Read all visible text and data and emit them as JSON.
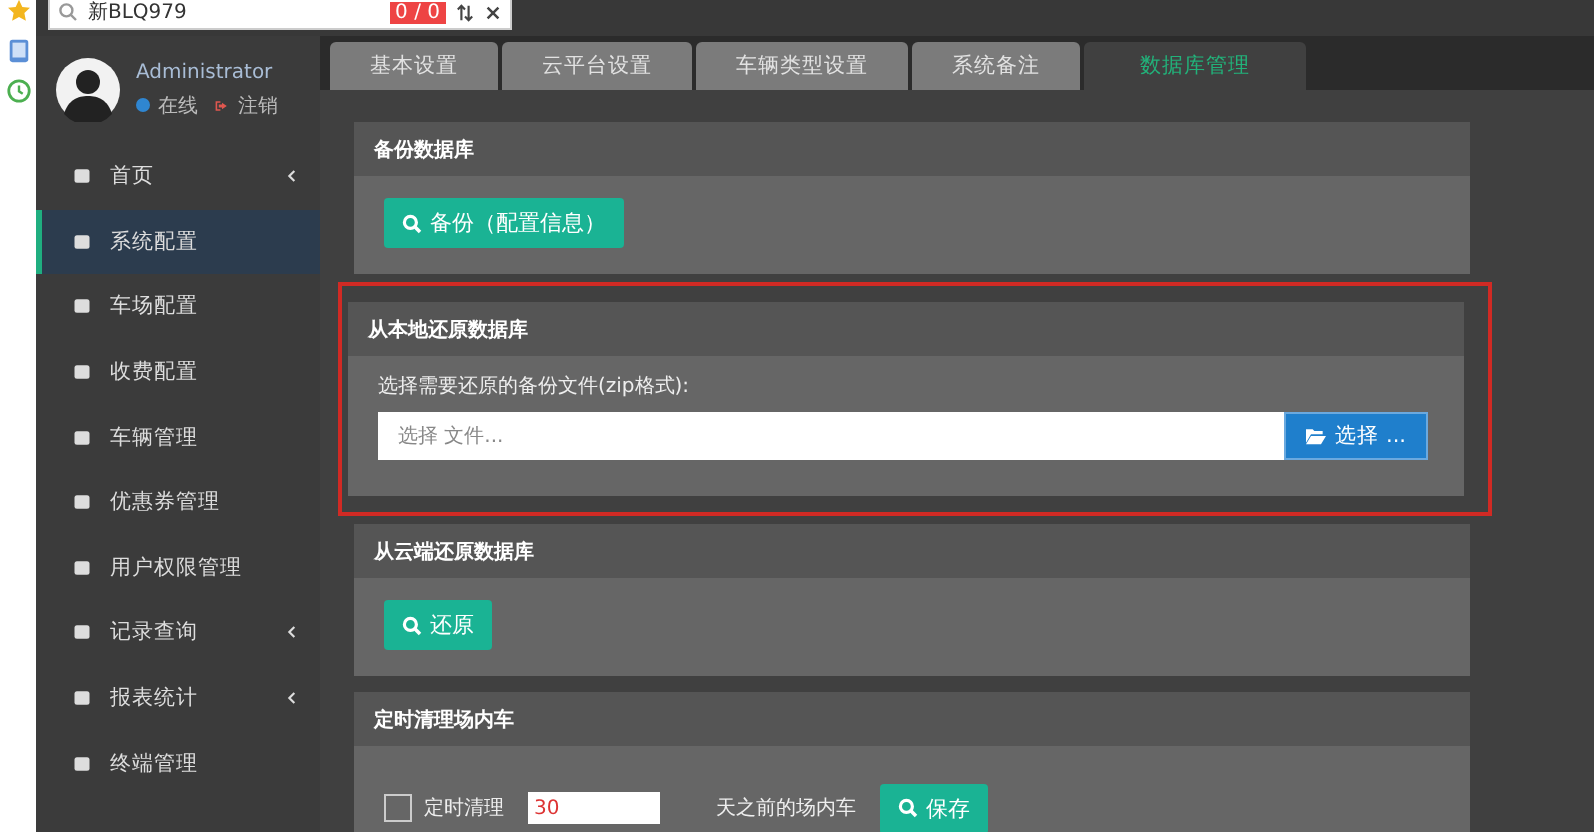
{
  "search": {
    "value": "新BLQ979",
    "count": "0 / 0"
  },
  "user": {
    "name": "Administrator",
    "status": "在线",
    "logout": "注销"
  },
  "menu": [
    {
      "label": "首页",
      "selected": false,
      "has_submenu": true
    },
    {
      "label": "系统配置",
      "selected": true,
      "has_submenu": false
    },
    {
      "label": "车场配置",
      "selected": false,
      "has_submenu": false
    },
    {
      "label": "收费配置",
      "selected": false,
      "has_submenu": false
    },
    {
      "label": "车辆管理",
      "selected": false,
      "has_submenu": false
    },
    {
      "label": "优惠券管理",
      "selected": false,
      "has_submenu": false
    },
    {
      "label": "用户权限管理",
      "selected": false,
      "has_submenu": false
    },
    {
      "label": "记录查询",
      "selected": false,
      "has_submenu": true
    },
    {
      "label": "报表统计",
      "selected": false,
      "has_submenu": true
    },
    {
      "label": "终端管理",
      "selected": false,
      "has_submenu": false
    }
  ],
  "tabs": [
    {
      "label": "基本设置",
      "selected": false
    },
    {
      "label": "云平台设置",
      "selected": false
    },
    {
      "label": "车辆类型设置",
      "selected": false
    },
    {
      "label": "系统备注",
      "selected": false
    },
    {
      "label": "数据库管理",
      "selected": true
    }
  ],
  "sections": [
    {
      "kind": "button",
      "title": "备份数据库",
      "highlighted": false,
      "button": "备份（配置信息）"
    },
    {
      "kind": "file",
      "title": "从本地还原数据库",
      "highlighted": true,
      "label": "选择需要还原的备份文件(zip格式):",
      "placeholder": "选择 文件...",
      "browse": "选择 ..."
    },
    {
      "kind": "button",
      "title": "从云端还原数据库",
      "highlighted": false,
      "button": "还原"
    },
    {
      "kind": "schedule",
      "title": "定时清理场内车",
      "highlighted": false,
      "checkbox_label": "定时清理",
      "checked": false,
      "days": "30",
      "suffix": "天之前的场内车",
      "button": "保存"
    }
  ]
}
